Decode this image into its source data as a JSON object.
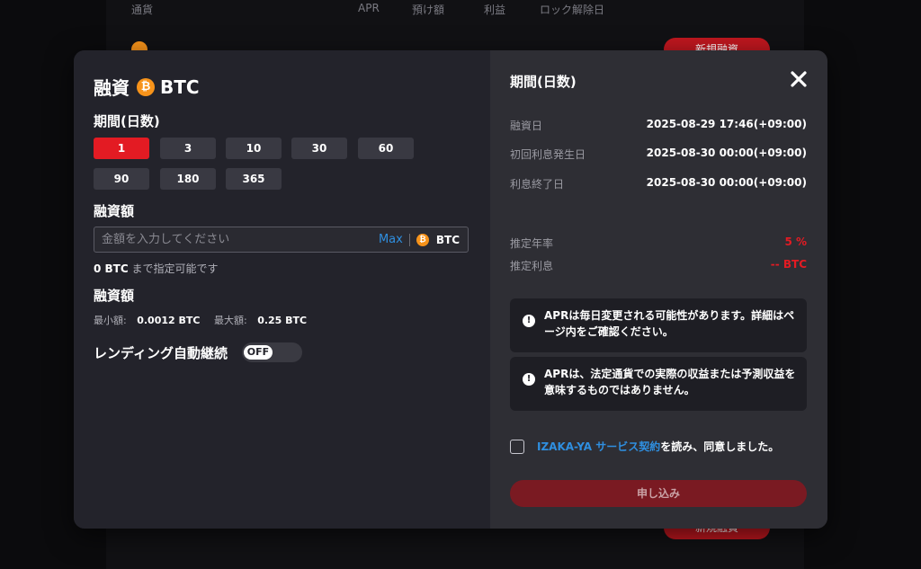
{
  "background": {
    "headers": [
      "通貨",
      "APR",
      "預け額",
      "利益",
      "ロック解除日"
    ],
    "action_button": "新規融資"
  },
  "modal": {
    "title_prefix": "融資",
    "coin_symbol": "BTC",
    "coin_glyph": "₿",
    "period_label": "期間(日数)",
    "periods": [
      "1",
      "3",
      "10",
      "30",
      "60",
      "90",
      "180",
      "365"
    ],
    "selected_period": "1",
    "amount_label": "融資額",
    "amount_input": {
      "placeholder": "金額を入力してください",
      "value": ""
    },
    "max_label": "Max",
    "unit": "BTC",
    "available_value": "0 BTC",
    "available_suffix": "まで指定可能です",
    "limits_label": "融資額",
    "min_label": "最小額:",
    "min_value": "0.0012 BTC",
    "max_limit_label": "最大額:",
    "max_limit_value": "0.25 BTC",
    "auto_label": "レンディング自動継続",
    "auto_toggle": "OFF"
  },
  "summary": {
    "title": "期間(日数)",
    "rows": [
      {
        "label": "融資日",
        "value": "2025-08-29 17:46(+09:00)"
      },
      {
        "label": "初回利息発生日",
        "value": "2025-08-30 00:00(+09:00)"
      },
      {
        "label": "利息終了日",
        "value": "2025-08-30 00:00(+09:00)"
      }
    ],
    "rate_label": "推定年率",
    "rate_value": "5 %",
    "interest_label": "推定利息",
    "interest_value": "-- BTC",
    "notices": [
      "APRは毎日変更される可能性があります。詳細はページ内をご確認ください。",
      "APRは、法定通貨での実際の収益または予測収益を意味するものではありません。"
    ],
    "agree_link": "IZAKA-YA サービス契約",
    "agree_text": "を読み、同意しました。",
    "submit_label": "申し込み"
  },
  "colors": {
    "accent": "#e31b23",
    "link": "#2f8fe0",
    "modal_left_bg": "#23232b",
    "modal_right_bg": "#2e2e34",
    "submit_bg": "#7a1a22"
  }
}
